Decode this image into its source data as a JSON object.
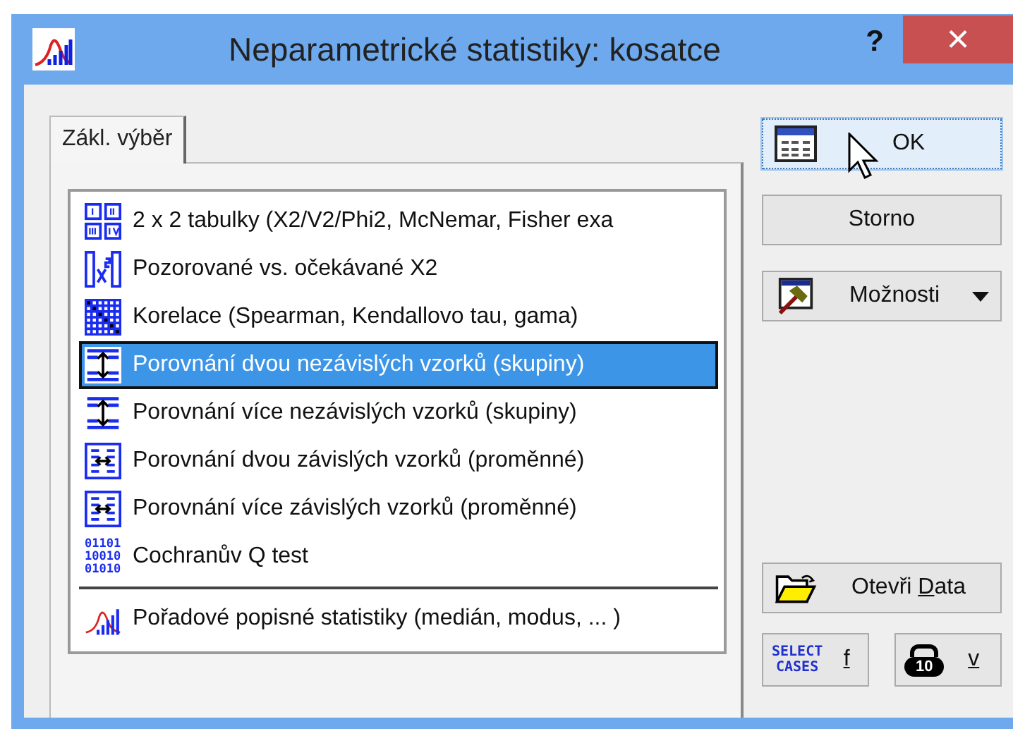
{
  "window": {
    "title": "Neparametrické statistiky: kosatce",
    "help": "?",
    "close": "×"
  },
  "tabs": [
    {
      "label": "Zákl. výběr",
      "selected": true
    }
  ],
  "list": [
    {
      "label": "2 x 2 tabulky (X2/V2/Phi2, McNemar, Fisher exa",
      "kind": "grid",
      "selected": false,
      "separator_before": false
    },
    {
      "label": "Pozorované vs. očekávané X2",
      "kind": "chisq",
      "selected": false,
      "separator_before": false
    },
    {
      "label": "Korelace (Spearman, Kendallovo tau, gama)",
      "kind": "matrix",
      "selected": false,
      "separator_before": false
    },
    {
      "label": "Porovnání dvou nezávislých vzorků (skupiny)",
      "kind": "updown",
      "selected": true,
      "separator_before": false
    },
    {
      "label": "Porovnání více nezávislých vzorků (skupiny)",
      "kind": "updown",
      "selected": false,
      "separator_before": false
    },
    {
      "label": "Porovnání dvou závislých vzorků (proměnné)",
      "kind": "leftright",
      "selected": false,
      "separator_before": false
    },
    {
      "label": "Porovnání více závislých vzorků (proměnné)",
      "kind": "leftright",
      "selected": false,
      "separator_before": false
    },
    {
      "label": "Cochranův Q test",
      "kind": "binary",
      "binary_text": [
        "01101",
        "10010",
        "01010"
      ],
      "selected": false,
      "separator_before": false
    },
    {
      "label": "Pořadové popisné statistiky (medián, modus, ... )",
      "kind": "distribution",
      "selected": false,
      "separator_before": true
    }
  ],
  "buttons": [
    {
      "label": "OK",
      "kind": "table",
      "focused": true,
      "dropdown": false
    },
    {
      "label": "Storno",
      "kind": "plain",
      "focused": false,
      "dropdown": false
    },
    {
      "label": "Možnosti",
      "kind": "hammer",
      "focused": false,
      "dropdown": true
    }
  ],
  "open_data": {
    "label_before": "Otevři ",
    "mnemonic": "D",
    "label_after": "ata"
  },
  "small_buttons": [
    {
      "label": "f",
      "kind": "select",
      "icon_text": [
        "SELECT",
        "CASES"
      ]
    },
    {
      "label": "v",
      "kind": "weight",
      "icon_text": [
        "10"
      ]
    }
  ]
}
